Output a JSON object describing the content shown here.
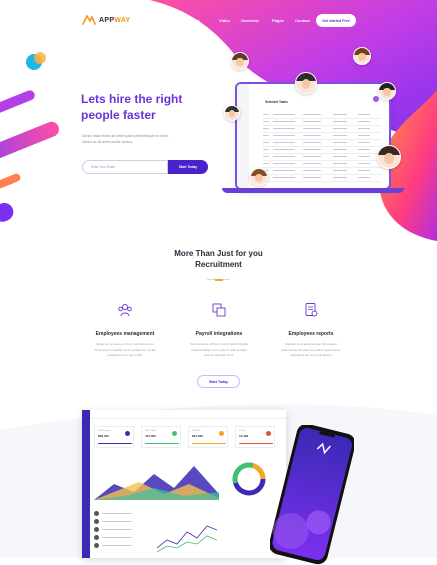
{
  "brand": {
    "name_part1": "APP",
    "name_part2": "WAY",
    "accent": "#f7941d"
  },
  "nav": {
    "items": [
      "Home",
      "Features",
      "Video",
      "Overview",
      "Pages",
      "Contact"
    ],
    "cta": "Get started Free"
  },
  "hero": {
    "title_line1": "Lets hire the right",
    "title_line2": "people faster",
    "desc_line1": "Donec vitae lectus sit amet quam pellentesque ni ntsed.",
    "desc_line2": "Ulnitor ac sit amet auctor cursus.",
    "input_placeholder": "Enter Your Email",
    "button": "Start Today",
    "laptop_title": "Selected Tasks"
  },
  "section": {
    "title_line1": "More Than Just for you",
    "title_line2": "Recruitment",
    "features": [
      {
        "icon": "team-icon",
        "title": "Employees management",
        "desc": [
          "Donec ac ex ante ex, Porro velit ante lorem",
          "Tincti ipsum curabitur et ac porttitor leo vel kill",
          "sodalisuat enim nec porttit."
        ]
      },
      {
        "icon": "payroll-icon",
        "title": "Payroll integrations",
        "desc": [
          "Fernt tempus ut Proin ut ipvrf Hillis Fringilla",
          "volutpat Nullam eros pelle ut velle porttitor",
          "pretium sed etim tincti."
        ]
      },
      {
        "icon": "report-icon",
        "title": "Employees reports",
        "desc": [
          "Aliquam id sit amet semper dit posuere",
          "pede Poneir dui ante sit porttitor ipsum lorem",
          "voluptatem est ut ut velit dictum."
        ]
      }
    ],
    "start_button": "Start Today"
  },
  "dashboard": {
    "kpis": [
      {
        "label": "Total Earnings",
        "value": "$68,453",
        "color": "#3a2ab5"
      },
      {
        "label": "Total Orders",
        "value": "472,590",
        "color": "#3fbf6f"
      },
      {
        "label": "Net Sales",
        "value": "$24,536",
        "color": "#f5a623"
      },
      {
        "label": "Visitors",
        "value": "12,482",
        "color": "#e74c3c"
      }
    ]
  },
  "colors": {
    "primary": "#4b22c9",
    "title": "#6b34d9",
    "pink": "#ff3d9a"
  }
}
